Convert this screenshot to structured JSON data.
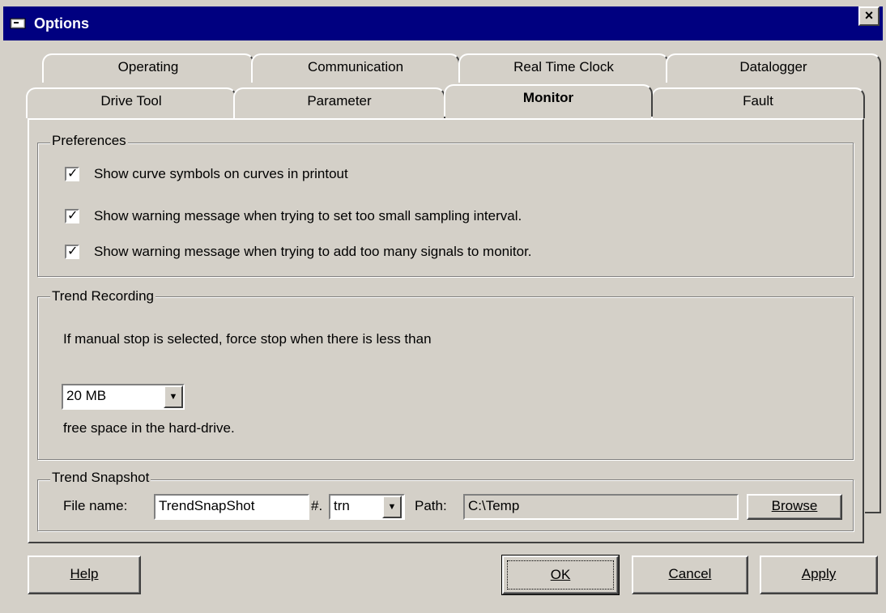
{
  "window": {
    "title": "Options",
    "close_label": "×"
  },
  "tabs": {
    "row1": [
      "Operating",
      "Communication",
      "Real Time Clock",
      "Datalogger"
    ],
    "row2": [
      "Drive Tool",
      "Parameter",
      "Monitor",
      "Fault"
    ],
    "active": "Monitor"
  },
  "preferences": {
    "label": "Preferences",
    "options": [
      {
        "label": "Show curve symbols on curves in printout",
        "checked": true
      },
      {
        "label": "Show warning message when trying to set too small sampling interval.",
        "checked": true
      },
      {
        "label": "Show warning message when trying to add too many signals to monitor.",
        "checked": true
      }
    ]
  },
  "trend_recording": {
    "label": "Trend Recording",
    "description": "If manual stop is selected, force stop when there is less than",
    "threshold_value": "20 MB",
    "suffix": "free space in the hard-drive."
  },
  "trend_snapshot": {
    "label": "Trend Snapshot",
    "file_name_label": "File name:",
    "file_name_value": "TrendSnapShot",
    "ext_separator": "#.",
    "extension_value": "trn",
    "path_label": "Path:",
    "path_value": "C:\\Temp",
    "browse_label": "Browse"
  },
  "buttons": {
    "help": "Help",
    "ok": "OK",
    "cancel": "Cancel",
    "apply": "Apply"
  }
}
